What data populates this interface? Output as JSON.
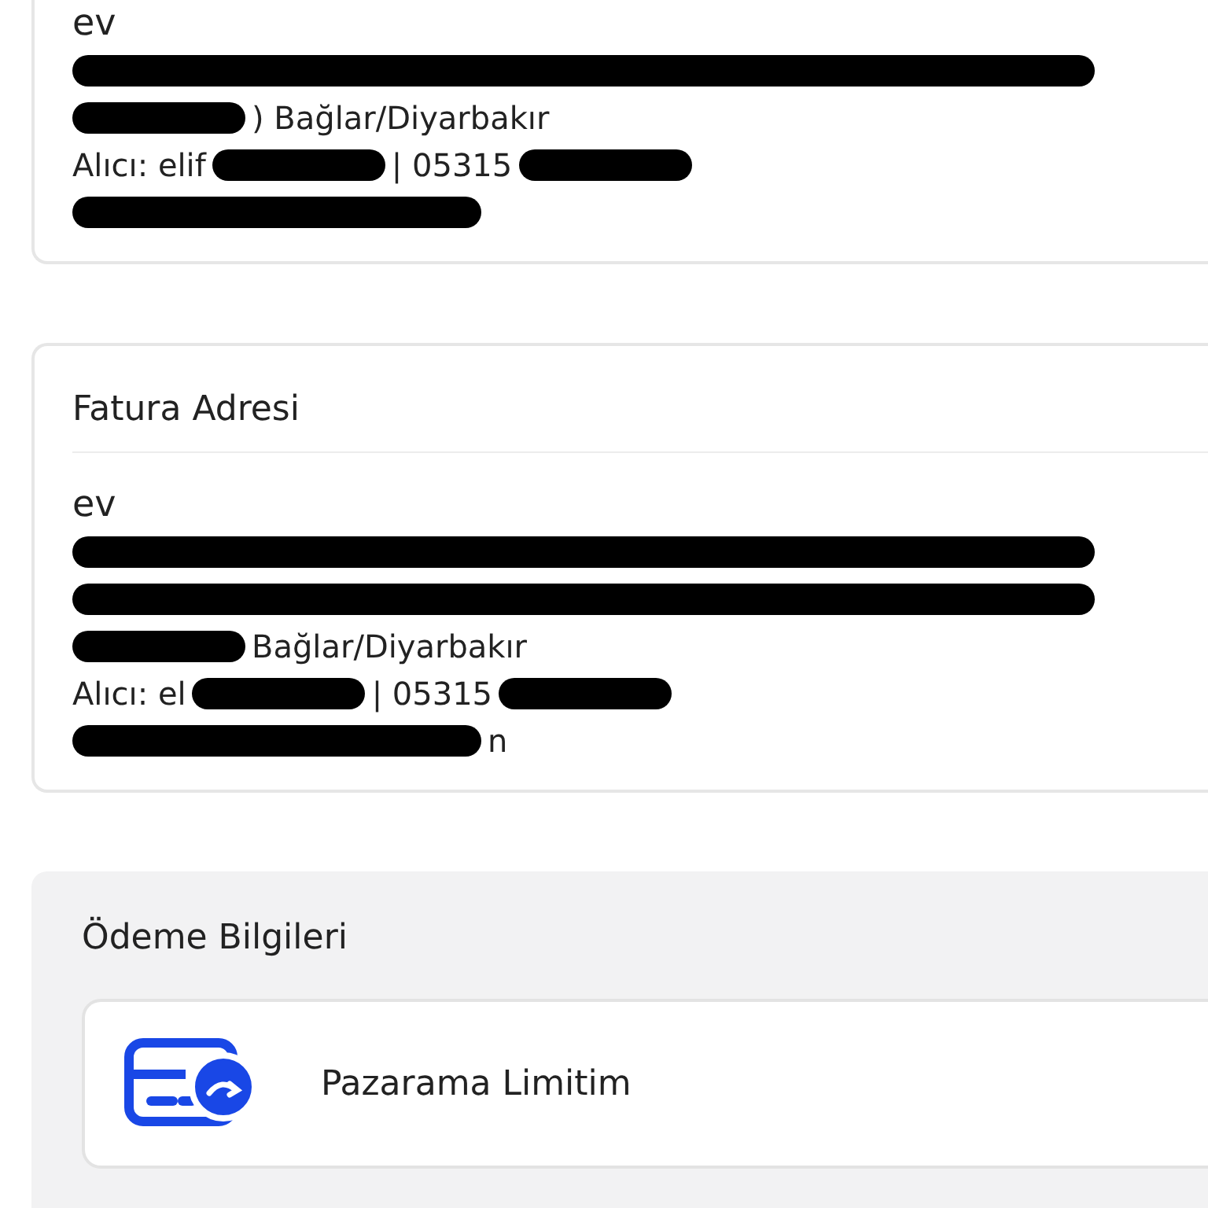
{
  "delivery_address": {
    "name": "ev",
    "lines": [
      [
        {
          "kind": "blackout"
        }
      ],
      [
        {
          "kind": "blot"
        },
        {
          "kind": "text",
          "text": ") Bağlar/Diyarbakır"
        }
      ],
      [
        {
          "kind": "text",
          "text": "Alıcı: elif"
        },
        {
          "kind": "blot"
        },
        {
          "kind": "text",
          "text": "| 05315"
        },
        {
          "kind": "blot"
        }
      ],
      [
        {
          "kind": "wide"
        }
      ]
    ]
  },
  "billing_address": {
    "title": "Fatura Adresi",
    "name": "ev",
    "lines": [
      [
        {
          "kind": "blackout"
        }
      ],
      [
        {
          "kind": "blackout"
        }
      ],
      [
        {
          "kind": "blot"
        },
        {
          "kind": "text",
          "text": "Bağlar/Diyarbakır"
        }
      ],
      [
        {
          "kind": "text",
          "text": "Alıcı: el"
        },
        {
          "kind": "blot"
        },
        {
          "kind": "text",
          "text": "| 05315"
        },
        {
          "kind": "blot"
        }
      ],
      [
        {
          "kind": "wide"
        },
        {
          "kind": "text",
          "text": "n"
        }
      ]
    ]
  },
  "payment": {
    "title": "Ödeme Bilgileri",
    "options": [
      {
        "label": "Pazarama Limitim"
      }
    ]
  }
}
